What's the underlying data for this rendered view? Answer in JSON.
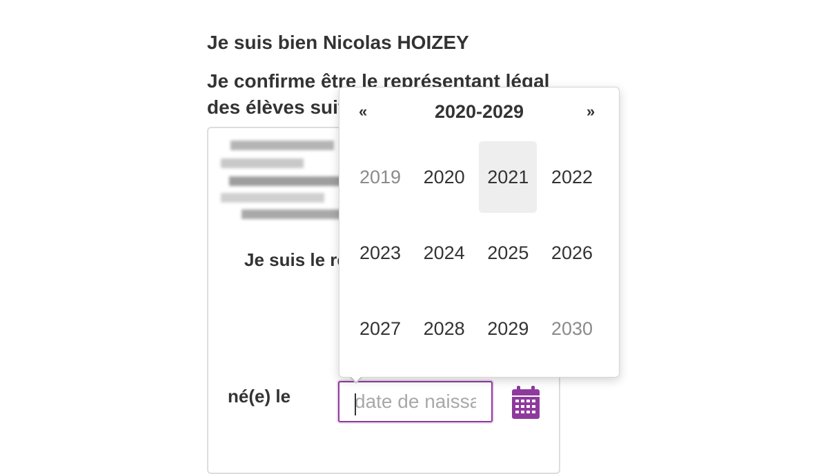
{
  "heading_identity": "Je suis bien Nicolas HOIZEY",
  "heading_confirm": "Je confirme être le représentant légal des élèves suiv",
  "card": {
    "role_text": "Je suis le re",
    "born_label": "né(e) le",
    "date_placeholder": "date de naissa"
  },
  "datepicker": {
    "prev": "«",
    "next": "»",
    "decade": "2020-2029",
    "years": [
      {
        "label": "2019",
        "state": "muted"
      },
      {
        "label": "2020",
        "state": "normal"
      },
      {
        "label": "2021",
        "state": "active"
      },
      {
        "label": "2022",
        "state": "normal"
      },
      {
        "label": "2023",
        "state": "normal"
      },
      {
        "label": "2024",
        "state": "normal"
      },
      {
        "label": "2025",
        "state": "normal"
      },
      {
        "label": "2026",
        "state": "normal"
      },
      {
        "label": "2027",
        "state": "normal"
      },
      {
        "label": "2028",
        "state": "normal"
      },
      {
        "label": "2029",
        "state": "normal"
      },
      {
        "label": "2030",
        "state": "muted"
      }
    ]
  },
  "icons": {
    "calendar": "calendar-icon"
  },
  "colors": {
    "accent": "#8e3a9d",
    "text": "#333333",
    "muted": "#8a8a8a",
    "active_bg": "#eeeeee"
  }
}
